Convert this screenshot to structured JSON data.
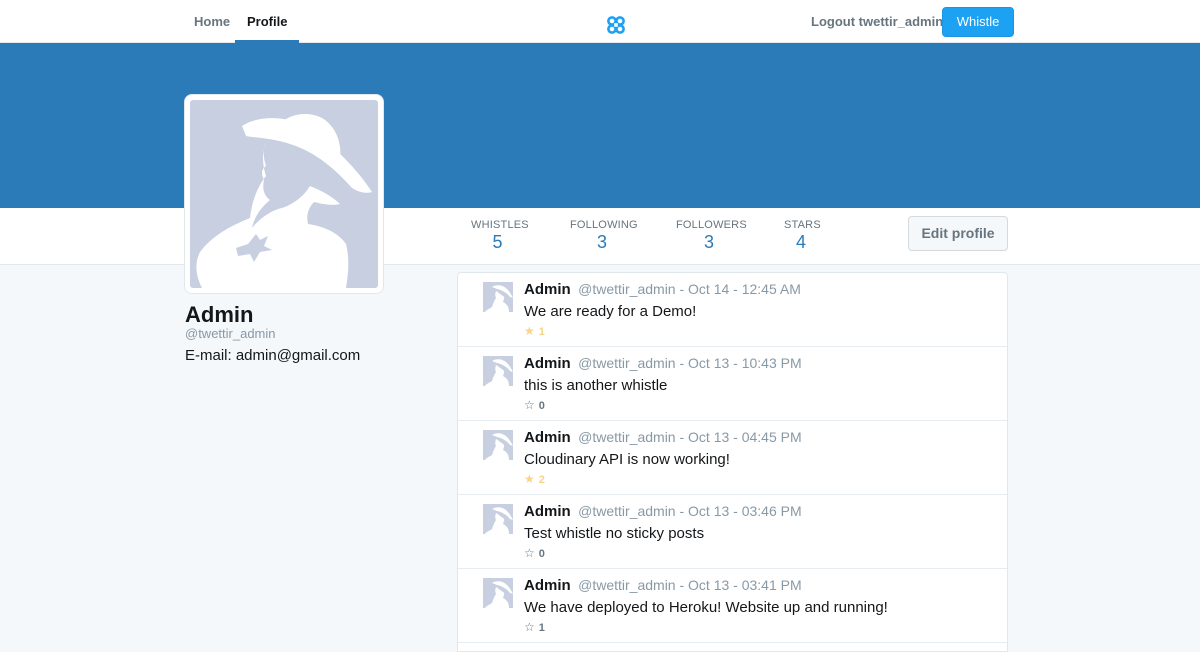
{
  "nav": {
    "tabs": [
      {
        "label": "Home"
      },
      {
        "label": "Profile"
      }
    ],
    "logout_label": "Logout twettir_admin",
    "whistle_button": "Whistle"
  },
  "stats": [
    {
      "label": "WHISTLES",
      "value": "5"
    },
    {
      "label": "FOLLOWING",
      "value": "3"
    },
    {
      "label": "FOLLOWERS",
      "value": "3"
    },
    {
      "label": "STARS",
      "value": "4"
    }
  ],
  "edit_profile_label": "Edit profile",
  "profile": {
    "name": "Admin",
    "handle": "@twettir_admin",
    "email": "E-mail: admin@gmail.com"
  },
  "whistles": [
    {
      "name": "Admin",
      "meta": "@twettir_admin - Oct 14 - 12:45 AM",
      "text": "We are ready for a Demo!",
      "stars": "1",
      "starred": true
    },
    {
      "name": "Admin",
      "meta": "@twettir_admin - Oct 13 - 10:43 PM",
      "text": "this is another whistle",
      "stars": "0",
      "starred": false
    },
    {
      "name": "Admin",
      "meta": "@twettir_admin - Oct 13 - 04:45 PM",
      "text": "Cloudinary API is now working!",
      "stars": "2",
      "starred": true
    },
    {
      "name": "Admin",
      "meta": "@twettir_admin - Oct 13 - 03:46 PM",
      "text": "Test whistle no sticky posts",
      "stars": "0",
      "starred": false
    },
    {
      "name": "Admin",
      "meta": "@twettir_admin - Oct 13 - 03:41 PM",
      "text": "We have deployed to Heroku! Website up and running!",
      "stars": "1",
      "starred": false
    }
  ],
  "colors": {
    "banner": "#2b7bb9",
    "accent": "#1da1f2",
    "star_active": "#f6d48a"
  },
  "icons": {
    "logo": "cloverleaf-logo-icon",
    "star_filled": "star-filled-icon",
    "star_outline": "star-outline-icon",
    "avatar": "default-avatar-icon"
  }
}
